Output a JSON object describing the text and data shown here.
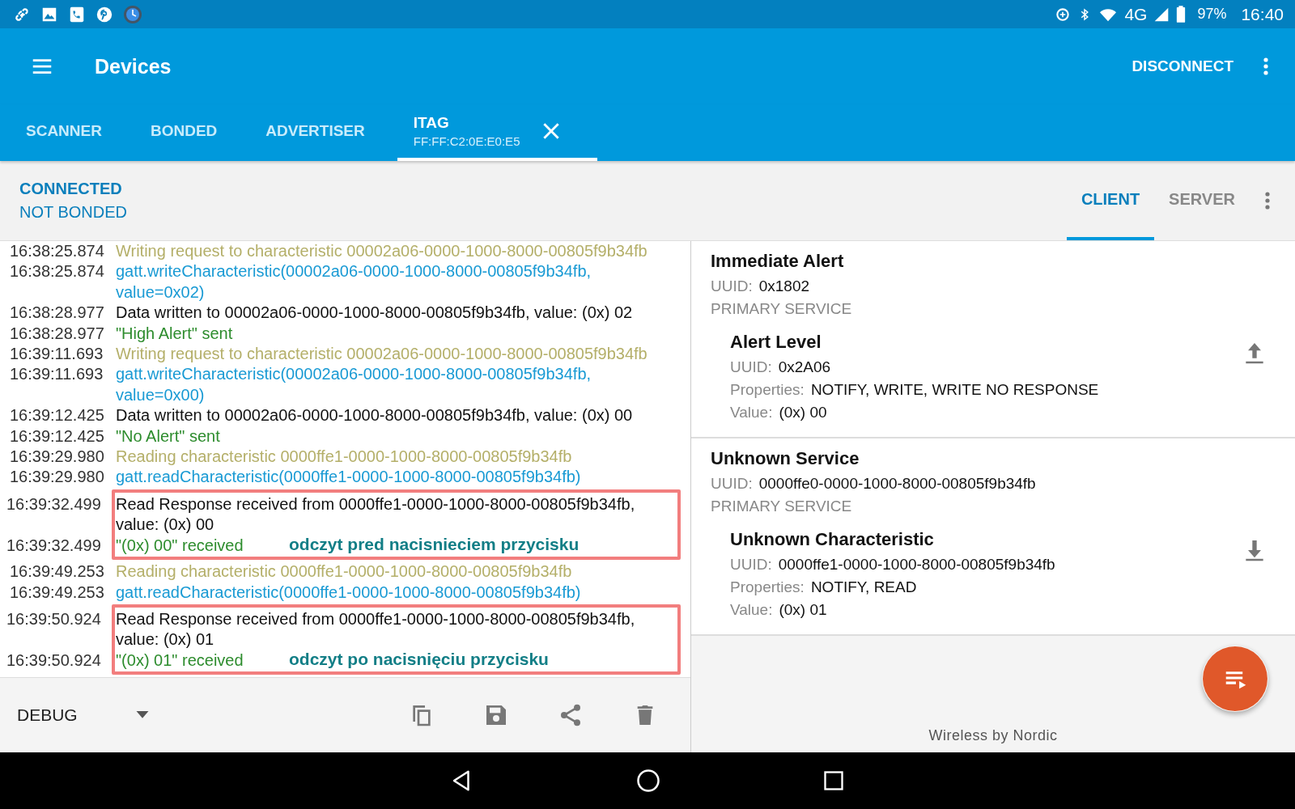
{
  "status_bar": {
    "network": "4G",
    "battery": "97%",
    "time": "16:40"
  },
  "app_bar": {
    "title": "Devices",
    "action": "DISCONNECT"
  },
  "tabs": [
    {
      "label": "SCANNER",
      "selected": false
    },
    {
      "label": "BONDED",
      "selected": false
    },
    {
      "label": "ADVERTISER",
      "selected": false
    },
    {
      "label": "ITAG",
      "subtitle": "FF:FF:C2:0E:E0:E5",
      "closable": true,
      "selected": true
    }
  ],
  "connection": {
    "state": "CONNECTED",
    "bond": "NOT BONDED"
  },
  "view_tabs": [
    {
      "label": "CLIENT",
      "selected": true
    },
    {
      "label": "SERVER",
      "selected": false
    }
  ],
  "log": [
    {
      "kind": "entry",
      "time": "16:38:25.874",
      "color": "#b4af69",
      "text": "Writing request to characteristic 00002a06-0000-1000-8000-00805f9b34fb"
    },
    {
      "kind": "entry",
      "time": "16:38:25.874",
      "color": "#199ad4",
      "text": "gatt.writeCharacteristic(00002a06-0000-1000-8000-00805f9b34fb, value=0x02)"
    },
    {
      "kind": "entry",
      "time": "16:38:28.977",
      "color": "#111111",
      "text": "Data written to 00002a06-0000-1000-8000-00805f9b34fb, value: (0x) 02"
    },
    {
      "kind": "entry",
      "time": "16:38:28.977",
      "color": "#2d8c2d",
      "text": "\"High Alert\" sent"
    },
    {
      "kind": "entry",
      "time": "16:39:11.693",
      "color": "#b4af69",
      "text": "Writing request to characteristic 00002a06-0000-1000-8000-00805f9b34fb"
    },
    {
      "kind": "entry",
      "time": "16:39:11.693",
      "color": "#199ad4",
      "text": "gatt.writeCharacteristic(00002a06-0000-1000-8000-00805f9b34fb, value=0x00)"
    },
    {
      "kind": "entry",
      "time": "16:39:12.425",
      "color": "#111111",
      "text": "Data written to 00002a06-0000-1000-8000-00805f9b34fb, value: (0x) 00"
    },
    {
      "kind": "entry",
      "time": "16:39:12.425",
      "color": "#2d8c2d",
      "text": "\"No Alert\" sent"
    },
    {
      "kind": "entry",
      "time": "16:39:29.980",
      "color": "#b4af69",
      "text": "Reading characteristic 0000ffe1-0000-1000-8000-00805f9b34fb"
    },
    {
      "kind": "entry",
      "time": "16:39:29.980",
      "color": "#199ad4",
      "text": "gatt.readCharacteristic(0000ffe1-0000-1000-8000-00805f9b34fb)"
    },
    {
      "kind": "callout",
      "note": "odczyt pred nacisnieciem przycisku",
      "entries": [
        {
          "time": "16:39:32.499",
          "color": "#111111",
          "text": "Read Response received from 0000ffe1-0000-1000-8000-00805f9b34fb, value: (0x) 00"
        },
        {
          "time": "16:39:32.499",
          "color": "#2d8c2d",
          "text": "\"(0x) 00\" received"
        }
      ]
    },
    {
      "kind": "entry",
      "time": "16:39:49.253",
      "color": "#b4af69",
      "text": "Reading characteristic 0000ffe1-0000-1000-8000-00805f9b34fb"
    },
    {
      "kind": "entry",
      "time": "16:39:49.253",
      "color": "#199ad4",
      "text": "gatt.readCharacteristic(0000ffe1-0000-1000-8000-00805f9b34fb)"
    },
    {
      "kind": "callout",
      "note": "odczyt po nacisnięciu przycisku",
      "entries": [
        {
          "time": "16:39:50.924",
          "color": "#111111",
          "text": "Read Response received from 0000ffe1-0000-1000-8000-00805f9b34fb, value: (0x) 01"
        },
        {
          "time": "16:39:50.924",
          "color": "#2d8c2d",
          "text": "\"(0x) 01\" received"
        }
      ]
    }
  ],
  "log_footer": {
    "log_level": "DEBUG"
  },
  "services": [
    {
      "name": "Immediate Alert",
      "uuid_label": "UUID:",
      "uuid": "0x1802",
      "type": "PRIMARY SERVICE",
      "characteristics": [
        {
          "name": "Alert Level",
          "kind": "write",
          "fields": [
            {
              "label": "UUID:",
              "value": "0x2A06"
            },
            {
              "label": "Properties:",
              "value": "NOTIFY, WRITE, WRITE NO RESPONSE"
            },
            {
              "label": "Value:",
              "value": "(0x) 00"
            }
          ]
        }
      ]
    },
    {
      "name": "Unknown Service",
      "uuid_label": "UUID:",
      "uuid": "0000ffe0-0000-1000-8000-00805f9b34fb",
      "type": "PRIMARY SERVICE",
      "characteristics": [
        {
          "name": "Unknown Characteristic",
          "kind": "read",
          "fields": [
            {
              "label": "UUID:",
              "value": "0000ffe1-0000-1000-8000-00805f9b34fb"
            },
            {
              "label": "Properties:",
              "value": "NOTIFY, READ"
            },
            {
              "label": "Value:",
              "value": "(0x) 01"
            }
          ]
        }
      ]
    }
  ],
  "brand": "Wireless by Nordic"
}
